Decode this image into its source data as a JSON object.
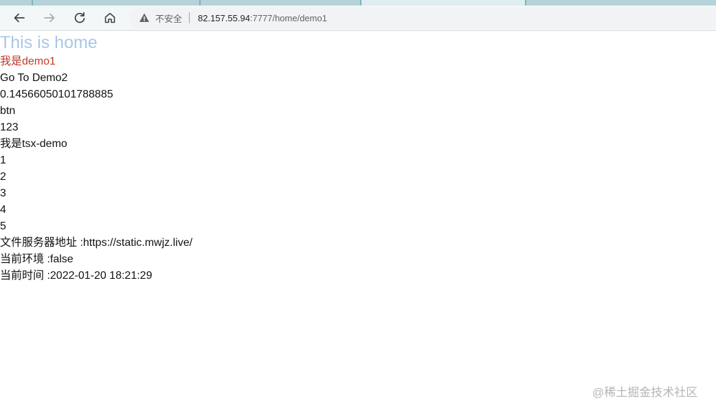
{
  "browser": {
    "security_label": "不安全",
    "url_host": "82.157.55.94",
    "url_rest": ":7777/home/demo1"
  },
  "icons": {
    "back": "arrow-left-icon",
    "forward": "arrow-right-icon",
    "reload": "reload-icon",
    "home": "home-icon",
    "security": "warning-triangle-icon"
  },
  "colors": {
    "title": "#a7c8e8",
    "demo1_text": "#c0392b",
    "tab_strip": "#7fb3bd",
    "watermark": "#b5b5b5"
  },
  "page": {
    "title": "This is home",
    "demo1": "我是demo1",
    "go_to_demo2": "Go To Demo2",
    "random_number": "0.14566050101788885",
    "btn": "btn",
    "value_123": "123",
    "tsx_demo": "我是tsx-demo",
    "list": [
      "1",
      "2",
      "3",
      "4",
      "5"
    ],
    "file_server": "文件服务器地址 :https://static.mwjz.live/",
    "env": "当前环境 :false",
    "time": "当前时间 :2022-01-20 18:21:29"
  },
  "watermark": "@稀土掘金技术社区"
}
